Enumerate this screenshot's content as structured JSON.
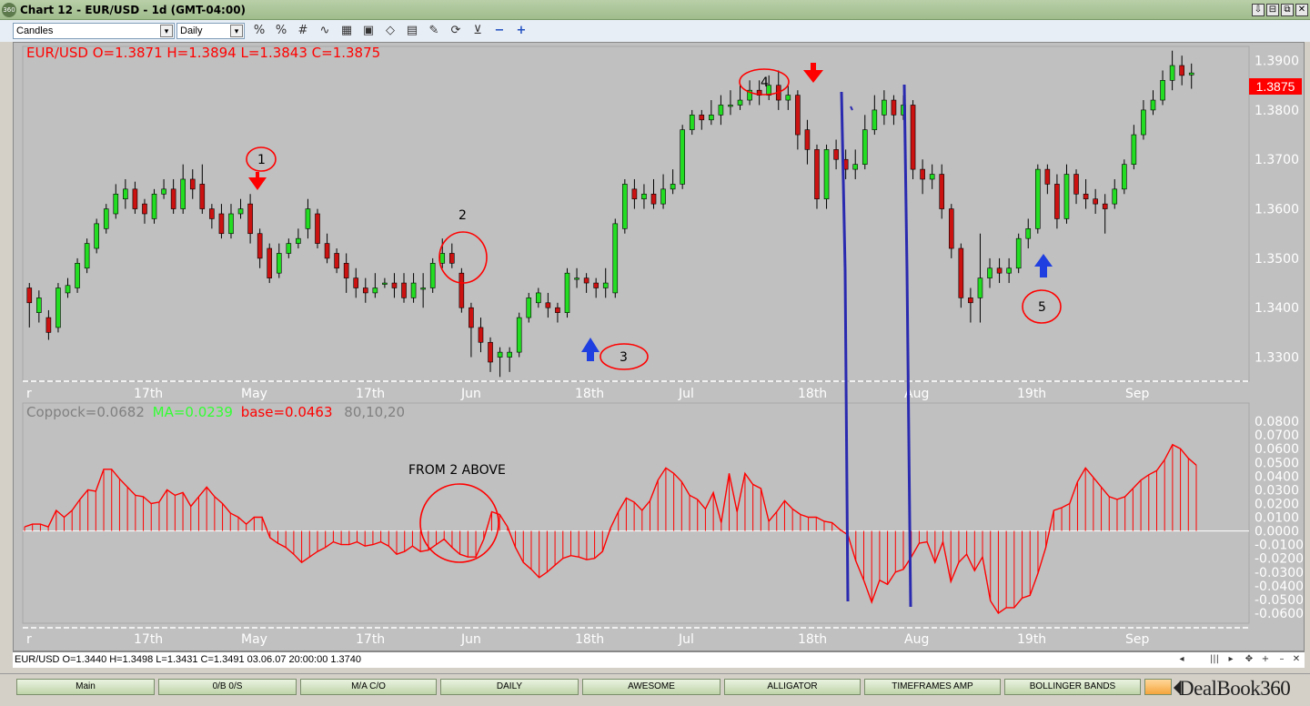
{
  "window": {
    "title": "Chart 12 - EUR/USD - 1d (GMT-04:00)",
    "app_badge": "360",
    "buttons": [
      "⇩",
      "⊟",
      "⧉",
      "✕"
    ]
  },
  "toolbar": {
    "chart_type": "Candles",
    "timeframe": "Daily",
    "icons": [
      "%-icon",
      "%-icon",
      "grid-icon",
      "wave-icon",
      "ruler-icon",
      "calculator-icon",
      "eraser-icon",
      "print-icon",
      "palette-icon",
      "refresh-icon",
      "funnel-icon",
      "zoom-out-icon",
      "zoom-in-icon"
    ]
  },
  "price_panel": {
    "header": "EUR/USD O=1.3871 H=1.3894 L=1.3843 C=1.3875",
    "current_price": "1.3875",
    "y_ticks": [
      "1.3900",
      "1.3800",
      "1.3700",
      "1.3600",
      "1.3500",
      "1.3400",
      "1.3300"
    ],
    "x_ticks": [
      "r",
      "17th",
      "May",
      "17th",
      "Jun",
      "18th",
      "Jul",
      "18th",
      "Aug",
      "19th",
      "Sep"
    ],
    "annotations": [
      "1",
      "2",
      "3",
      "4",
      "5"
    ]
  },
  "indicator_panel": {
    "label_coppock": "Coppock=0.0682",
    "label_ma": "MA=0.0239",
    "label_base": "base=0.0463",
    "label_params": "80,10,20",
    "note": "FROM 2 ABOVE",
    "y_ticks": [
      "0.0800",
      "0.0700",
      "0.0600",
      "0.0500",
      "0.0400",
      "0.0300",
      "0.0200",
      "0.0100",
      "0.0000",
      "-0.0100",
      "-0.0200",
      "-0.0300",
      "-0.0400",
      "-0.0500",
      "-0.0600"
    ],
    "x_ticks": [
      "r",
      "17th",
      "May",
      "17th",
      "Jun",
      "18th",
      "Jul",
      "18th",
      "Aug",
      "19th",
      "Sep"
    ]
  },
  "status": {
    "text": "EUR/USD O=1.3440 H=1.3498 L=1.3431 C=1.3491   03.06.07 20:00:00 1.3740",
    "controls": [
      "◂",
      "|||",
      "▸",
      "✥",
      "+",
      "–",
      "✕"
    ]
  },
  "tabs": [
    "Main",
    "0/B 0/S",
    "M/A C/O",
    "DAILY",
    "AWESOME",
    "ALLIGATOR",
    "TIMEFRAMES AMP",
    "BOLLINGER BANDS",
    ""
  ],
  "logo": {
    "text": "DealBook",
    "num": "360"
  },
  "chart_data": [
    {
      "type": "candlestick",
      "title": "EUR/USD O=1.3871 H=1.3894 L=1.3843 C=1.3875",
      "ylim": [
        1.3255,
        1.3925
      ],
      "y_ticks": [
        1.39,
        1.38,
        1.37,
        1.36,
        1.35,
        1.34,
        1.33
      ],
      "candles": [
        [
          1.344,
          1.341,
          1.345,
          1.336
        ],
        [
          1.339,
          1.342,
          1.3435,
          1.337
        ],
        [
          1.338,
          1.335,
          1.3395,
          1.3335
        ],
        [
          1.336,
          1.344,
          1.345,
          1.335
        ],
        [
          1.343,
          1.3445,
          1.346,
          1.342
        ],
        [
          1.344,
          1.349,
          1.35,
          1.343
        ],
        [
          1.348,
          1.353,
          1.354,
          1.347
        ],
        [
          1.352,
          1.357,
          1.358,
          1.351
        ],
        [
          1.356,
          1.36,
          1.361,
          1.355
        ],
        [
          1.359,
          1.363,
          1.365,
          1.358
        ],
        [
          1.362,
          1.364,
          1.366,
          1.36
        ],
        [
          1.364,
          1.36,
          1.3655,
          1.359
        ],
        [
          1.361,
          1.359,
          1.362,
          1.357
        ],
        [
          1.358,
          1.363,
          1.364,
          1.357
        ],
        [
          1.363,
          1.364,
          1.366,
          1.362
        ],
        [
          1.364,
          1.36,
          1.366,
          1.359
        ],
        [
          1.36,
          1.366,
          1.369,
          1.359
        ],
        [
          1.366,
          1.364,
          1.368,
          1.362
        ],
        [
          1.365,
          1.36,
          1.369,
          1.359
        ],
        [
          1.36,
          1.358,
          1.361,
          1.356
        ],
        [
          1.359,
          1.355,
          1.361,
          1.354
        ],
        [
          1.355,
          1.359,
          1.361,
          1.354
        ],
        [
          1.359,
          1.36,
          1.362,
          1.358
        ],
        [
          1.361,
          1.355,
          1.363,
          1.353
        ],
        [
          1.355,
          1.35,
          1.356,
          1.348
        ],
        [
          1.352,
          1.346,
          1.353,
          1.345
        ],
        [
          1.347,
          1.351,
          1.353,
          1.346
        ],
        [
          1.351,
          1.353,
          1.354,
          1.35
        ],
        [
          1.353,
          1.354,
          1.356,
          1.352
        ],
        [
          1.356,
          1.36,
          1.362,
          1.354
        ],
        [
          1.359,
          1.353,
          1.36,
          1.352
        ],
        [
          1.353,
          1.35,
          1.355,
          1.349
        ],
        [
          1.351,
          1.348,
          1.352,
          1.347
        ],
        [
          1.349,
          1.346,
          1.351,
          1.343
        ],
        [
          1.346,
          1.344,
          1.348,
          1.342
        ],
        [
          1.344,
          1.343,
          1.346,
          1.341
        ],
        [
          1.343,
          1.344,
          1.347,
          1.342
        ],
        [
          1.345,
          1.345,
          1.346,
          1.344
        ],
        [
          1.345,
          1.344,
          1.347,
          1.342
        ],
        [
          1.345,
          1.342,
          1.347,
          1.341
        ],
        [
          1.342,
          1.345,
          1.347,
          1.341
        ],
        [
          1.344,
          1.344,
          1.347,
          1.34
        ],
        [
          1.344,
          1.349,
          1.35,
          1.343
        ],
        [
          1.349,
          1.351,
          1.354,
          1.348
        ],
        [
          1.351,
          1.349,
          1.353,
          1.348
        ],
        [
          1.347,
          1.34,
          1.348,
          1.339
        ],
        [
          1.34,
          1.336,
          1.341,
          1.33
        ],
        [
          1.336,
          1.333,
          1.338,
          1.331
        ],
        [
          1.333,
          1.329,
          1.334,
          1.327
        ],
        [
          1.33,
          1.331,
          1.332,
          1.326
        ],
        [
          1.33,
          1.331,
          1.332,
          1.327
        ],
        [
          1.331,
          1.338,
          1.339,
          1.33
        ],
        [
          1.338,
          1.342,
          1.343,
          1.337
        ],
        [
          1.341,
          1.343,
          1.344,
          1.34
        ],
        [
          1.341,
          1.34,
          1.343,
          1.338
        ],
        [
          1.34,
          1.339,
          1.341,
          1.337
        ],
        [
          1.339,
          1.347,
          1.348,
          1.338
        ],
        [
          1.346,
          1.346,
          1.348,
          1.344
        ],
        [
          1.346,
          1.345,
          1.347,
          1.343
        ],
        [
          1.345,
          1.344,
          1.346,
          1.342
        ],
        [
          1.344,
          1.345,
          1.348,
          1.342
        ],
        [
          1.343,
          1.357,
          1.358,
          1.342
        ],
        [
          1.356,
          1.365,
          1.366,
          1.355
        ],
        [
          1.364,
          1.362,
          1.366,
          1.36
        ],
        [
          1.362,
          1.363,
          1.365,
          1.36
        ],
        [
          1.363,
          1.361,
          1.366,
          1.36
        ],
        [
          1.361,
          1.364,
          1.367,
          1.36
        ],
        [
          1.364,
          1.365,
          1.368,
          1.363
        ],
        [
          1.365,
          1.376,
          1.377,
          1.364
        ],
        [
          1.376,
          1.379,
          1.38,
          1.375
        ],
        [
          1.379,
          1.378,
          1.38,
          1.376
        ],
        [
          1.378,
          1.379,
          1.382,
          1.377
        ],
        [
          1.379,
          1.381,
          1.383,
          1.377
        ],
        [
          1.381,
          1.381,
          1.384,
          1.379
        ],
        [
          1.381,
          1.382,
          1.385,
          1.38
        ],
        [
          1.382,
          1.384,
          1.386,
          1.381
        ],
        [
          1.384,
          1.383,
          1.386,
          1.381
        ],
        [
          1.383,
          1.385,
          1.387,
          1.382
        ],
        [
          1.385,
          1.382,
          1.388,
          1.38
        ],
        [
          1.382,
          1.383,
          1.385,
          1.38
        ],
        [
          1.383,
          1.375,
          1.384,
          1.372
        ],
        [
          1.376,
          1.372,
          1.378,
          1.369
        ],
        [
          1.372,
          1.362,
          1.373,
          1.36
        ],
        [
          1.362,
          1.372,
          1.373,
          1.36
        ],
        [
          1.372,
          1.37,
          1.374,
          1.368
        ],
        [
          1.37,
          1.368,
          1.372,
          1.366
        ],
        [
          1.368,
          1.369,
          1.372,
          1.366
        ],
        [
          1.369,
          1.376,
          1.379,
          1.368
        ],
        [
          1.376,
          1.38,
          1.383,
          1.375
        ],
        [
          1.379,
          1.382,
          1.384,
          1.377
        ],
        [
          1.382,
          1.379,
          1.383,
          1.377
        ],
        [
          1.379,
          1.381,
          1.383,
          1.378
        ],
        [
          1.381,
          1.368,
          1.382,
          1.366
        ],
        [
          1.368,
          1.366,
          1.37,
          1.363
        ],
        [
          1.366,
          1.367,
          1.369,
          1.364
        ],
        [
          1.367,
          1.36,
          1.369,
          1.358
        ],
        [
          1.36,
          1.352,
          1.361,
          1.35
        ],
        [
          1.352,
          1.342,
          1.353,
          1.34
        ],
        [
          1.342,
          1.341,
          1.344,
          1.337
        ],
        [
          1.342,
          1.346,
          1.355,
          1.337
        ],
        [
          1.346,
          1.348,
          1.35,
          1.344
        ],
        [
          1.348,
          1.347,
          1.35,
          1.345
        ],
        [
          1.347,
          1.348,
          1.35,
          1.345
        ],
        [
          1.348,
          1.354,
          1.355,
          1.347
        ],
        [
          1.354,
          1.356,
          1.358,
          1.352
        ],
        [
          1.356,
          1.368,
          1.369,
          1.355
        ],
        [
          1.368,
          1.365,
          1.369,
          1.363
        ],
        [
          1.365,
          1.358,
          1.367,
          1.356
        ],
        [
          1.358,
          1.367,
          1.369,
          1.357
        ],
        [
          1.367,
          1.363,
          1.368,
          1.361
        ],
        [
          1.363,
          1.362,
          1.366,
          1.36
        ],
        [
          1.362,
          1.361,
          1.364,
          1.359
        ],
        [
          1.361,
          1.36,
          1.363,
          1.355
        ],
        [
          1.361,
          1.364,
          1.366,
          1.36
        ],
        [
          1.364,
          1.369,
          1.37,
          1.363
        ],
        [
          1.369,
          1.375,
          1.377,
          1.368
        ],
        [
          1.375,
          1.38,
          1.382,
          1.374
        ],
        [
          1.38,
          1.382,
          1.384,
          1.379
        ],
        [
          1.382,
          1.386,
          1.388,
          1.381
        ],
        [
          1.386,
          1.389,
          1.392,
          1.384
        ],
        [
          1.389,
          1.387,
          1.391,
          1.385
        ],
        [
          1.3871,
          1.3875,
          1.3894,
          1.3843
        ]
      ]
    },
    {
      "type": "bar",
      "title": "Coppock=0.0682 MA=0.0239 base=0.0463 80,10,20",
      "ylim": [
        -0.066,
        0.092
      ],
      "values": [
        0.003,
        0.005,
        0.005,
        0.003,
        0.015,
        0.01,
        0.015,
        0.023,
        0.03,
        0.029,
        0.045,
        0.045,
        0.038,
        0.032,
        0.026,
        0.025,
        0.02,
        0.021,
        0.03,
        0.026,
        0.028,
        0.018,
        0.025,
        0.032,
        0.025,
        0.02,
        0.013,
        0.01,
        0.005,
        0.01,
        0.01,
        -0.005,
        -0.009,
        -0.012,
        -0.017,
        -0.023,
        -0.019,
        -0.015,
        -0.012,
        -0.008,
        -0.01,
        -0.01,
        -0.008,
        -0.011,
        -0.01,
        -0.008,
        -0.011,
        -0.017,
        -0.015,
        -0.011,
        -0.015,
        -0.014,
        -0.01,
        -0.006,
        -0.012,
        -0.017,
        -0.019,
        -0.019,
        -0.006,
        0.014,
        0.012,
        0.003,
        -0.012,
        -0.023,
        -0.028,
        -0.034,
        -0.03,
        -0.025,
        -0.02,
        -0.018,
        -0.019,
        -0.021,
        -0.02,
        -0.015,
        0.002,
        0.014,
        0.024,
        0.021,
        0.015,
        0.022,
        0.037,
        0.046,
        0.042,
        0.036,
        0.026,
        0.023,
        0.016,
        0.028,
        0.006,
        0.042,
        0.014,
        0.042,
        0.034,
        0.031,
        0.007,
        0.014,
        0.022,
        0.016,
        0.012,
        0.01,
        0.01,
        0.007,
        0.006,
        0.001,
        -0.003,
        -0.022,
        -0.036,
        -0.052,
        -0.036,
        -0.039,
        -0.03,
        -0.028,
        -0.019,
        -0.009,
        -0.008,
        -0.023,
        -0.008,
        -0.037,
        -0.023,
        -0.017,
        -0.029,
        -0.019,
        -0.051,
        -0.06,
        -0.056,
        -0.056,
        -0.049,
        -0.047,
        -0.031,
        -0.012,
        0.015,
        0.017,
        0.02,
        0.036,
        0.046,
        0.039,
        0.032,
        0.025,
        0.023,
        0.025,
        0.031,
        0.037,
        0.041,
        0.044,
        0.052,
        0.063,
        0.06,
        0.053,
        0.048
      ],
      "line_y": "0.0000"
    }
  ]
}
